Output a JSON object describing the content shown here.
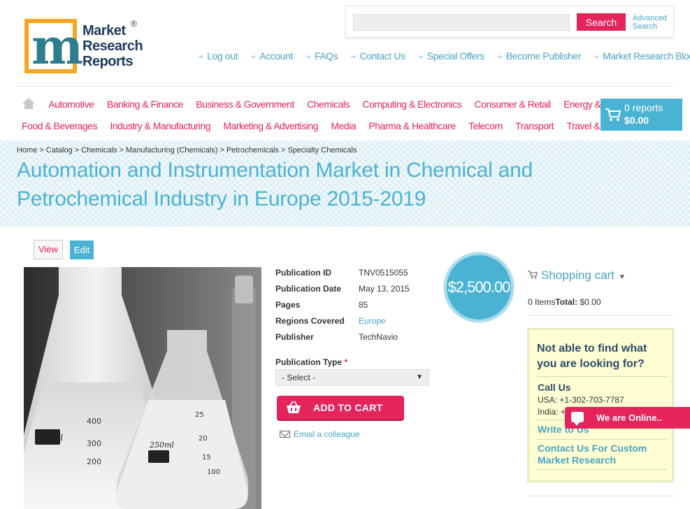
{
  "brand": {
    "logo_lines": [
      "Market",
      "Research",
      "Reports"
    ],
    "registered": "®",
    "accent_color": "#e4245a",
    "link_color": "#4aa3c4",
    "primary_color": "#4ab3d3"
  },
  "search": {
    "placeholder": "",
    "button_label": "Search",
    "advanced_label_1": "Advanced",
    "advanced_label_2": "Search"
  },
  "top_nav": {
    "items": [
      "Log out",
      "Account",
      "FAQs",
      "Contact Us",
      "Special Offers",
      "Become Publisher",
      "Market Research Blog"
    ]
  },
  "categories": {
    "row1": [
      "Automotive",
      "Banking & Finance",
      "Business & Government",
      "Chemicals",
      "Computing & Electronics",
      "Consumer & Retail",
      "Energy & Utilities"
    ],
    "row2": [
      "Food & Beverages",
      "Industry & Manufacturing",
      "Marketing & Advertising",
      "Media",
      "Pharma & Healthcare",
      "Telecom",
      "Transport",
      "Travel & Leisure"
    ]
  },
  "cart_button": {
    "count": "0 reports",
    "total": "$0.00"
  },
  "breadcrumb": [
    "Home",
    "Catalog",
    "Chemicals",
    "Manufacturing (Chemicals)",
    "Petrochemicals",
    "Specialty Chemicals"
  ],
  "page_title": "Automation and Instrumentation Market in Chemical and Petrochemical Industry in Europe 2015-2019",
  "tabs": {
    "view": "View",
    "edit": "Edit"
  },
  "product_image": {
    "flask_labels": {
      "left_capacity": "500ml",
      "left_marks": [
        "400",
        "300",
        "200"
      ],
      "right_capacity": "250ml",
      "right_marks": [
        "25",
        "20",
        "15",
        "100"
      ]
    }
  },
  "details": {
    "publication_id_label": "Publication ID",
    "publication_id": "TNV0515055",
    "publication_date_label": "Publication Date",
    "publication_date": "May 13, 2015",
    "pages_label": "Pages",
    "pages": "85",
    "regions_label": "Regions Covered",
    "regions": "Europe",
    "publisher_label": "Publisher",
    "publisher": "TechNavio"
  },
  "publication_type": {
    "label": "Publication Type",
    "required_mark": "*",
    "selected": "- Select -"
  },
  "add_to_cart_label": "ADD TO CART",
  "email_colleague_label": "Email a colleague",
  "price": "$2,500.00",
  "shopping_cart": {
    "title": "Shopping cart",
    "items_text": "0 Items",
    "total_label": "Total:",
    "total_value": "$0.00"
  },
  "help_box": {
    "heading": "Not able to find what you are looking for?",
    "call_us": "Call Us",
    "usa": "USA: +1-302-703-7787",
    "india": "India: +",
    "write_to_us": "Write to Us",
    "contact_custom": "Contact Us For Custom Market Research"
  },
  "chat": {
    "label": "We are Online.."
  }
}
